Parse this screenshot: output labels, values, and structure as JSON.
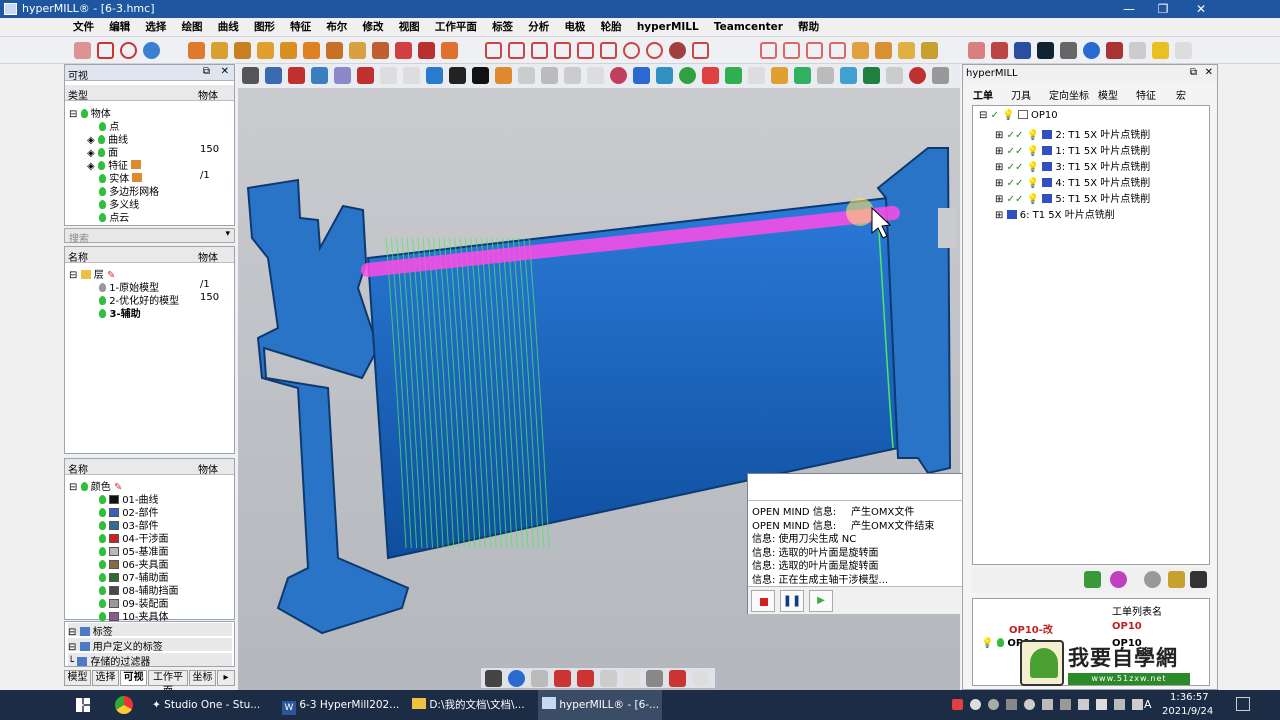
{
  "window": {
    "title": "hyperMILL® - [6-3.hmc]"
  },
  "menu": [
    "文件",
    "编辑",
    "选择",
    "绘图",
    "曲线",
    "图形",
    "特征",
    "布尔",
    "修改",
    "视图",
    "工作平面",
    "标签",
    "分析",
    "电极",
    "轮胎",
    "hyperMILL",
    "Teamcenter",
    "帮助"
  ],
  "left": {
    "visible_panel": {
      "title": "可视",
      "col_type": "类型",
      "col_obj": "物体",
      "items": [
        {
          "label": "物体",
          "count": ""
        },
        {
          "label": "点",
          "count": ""
        },
        {
          "label": "曲线",
          "count": ""
        },
        {
          "label": "面",
          "count": "150"
        },
        {
          "label": "特征",
          "count": ""
        },
        {
          "label": "实体",
          "count": "/1"
        },
        {
          "label": "多边形网格",
          "count": ""
        },
        {
          "label": "多义线",
          "count": ""
        },
        {
          "label": "点云",
          "count": ""
        }
      ]
    },
    "search": {
      "placeholder": "搜索"
    },
    "layers": {
      "col_name": "名称",
      "col_obj": "物体",
      "root": "层",
      "items": [
        {
          "label": "1-原始模型",
          "count": "/1"
        },
        {
          "label": "2-优化好的模型",
          "count": "150"
        },
        {
          "label": "3-辅助",
          "count": ""
        }
      ]
    },
    "colors": {
      "col_name": "名称",
      "col_obj": "物体",
      "root": "颜色",
      "items": [
        {
          "label": "01-曲线",
          "color": "#111111"
        },
        {
          "label": "02-部件",
          "color": "#3a5fc0"
        },
        {
          "label": "03-部件",
          "color": "#2f6f8f"
        },
        {
          "label": "04-干涉面",
          "color": "#d02020"
        },
        {
          "label": "05-基准面",
          "color": "#b8b8b8"
        },
        {
          "label": "06-夹具面",
          "color": "#8a6a40"
        },
        {
          "label": "07-辅助面",
          "color": "#2f6a2f"
        },
        {
          "label": "08-辅助挡面",
          "color": "#4a4a4a"
        },
        {
          "label": "09-装配面",
          "color": "#9a9a9a"
        },
        {
          "label": "10-夹具体",
          "color": "#8a5a8a"
        }
      ]
    },
    "groups": [
      "标签",
      "用户定义的标签",
      "存储的过滤器"
    ],
    "bottom_tabs": [
      "模型",
      "选择",
      "可视",
      "工作平面",
      "坐标"
    ]
  },
  "right": {
    "title": "hyperMILL",
    "tabs": [
      "工单",
      "刀具",
      "定向坐标",
      "模型",
      "特征",
      "宏"
    ],
    "tree_root": "OP10",
    "jobs": [
      "2: T1 5X 叶片点铣削",
      "1: T1 5X 叶片点铣削",
      "3: T1 5X 叶片点铣削",
      "4: T1 5X 叶片点铣削",
      "5: T1 5X 叶片点铣削",
      "6: T1 5X 叶片点铣削"
    ],
    "joblist_header": "工单列表名",
    "joblist": [
      {
        "a": "OP10-改",
        "b": "OP10"
      },
      {
        "a": "OP10",
        "b": "OP10"
      }
    ]
  },
  "messages": {
    "lines": [
      [
        "OPEN MIND 信息:",
        "产生OMX文件"
      ],
      [
        "OPEN MIND 信息:",
        "产生OMX文件结束"
      ],
      [
        "信息: 使用刀尖生成 NC",
        ""
      ],
      [
        "信息: 选取的叶片面是旋转面",
        ""
      ],
      [
        "信息: 选取的叶片面是旋转面",
        ""
      ],
      [
        "信息: 正在生成主轴干涉模型...",
        ""
      ]
    ]
  },
  "watermark": {
    "text": "我要自學網",
    "url": "www.51zxw.net"
  },
  "taskbar": {
    "items": [
      "Studio One - Stu...",
      "6-3 HyperMill202...",
      "D:\\我的文档\\文档\\...",
      "hyperMILL® - [6-..."
    ],
    "ime": "A",
    "time": "1:36:57",
    "date": "2021/9/24"
  }
}
